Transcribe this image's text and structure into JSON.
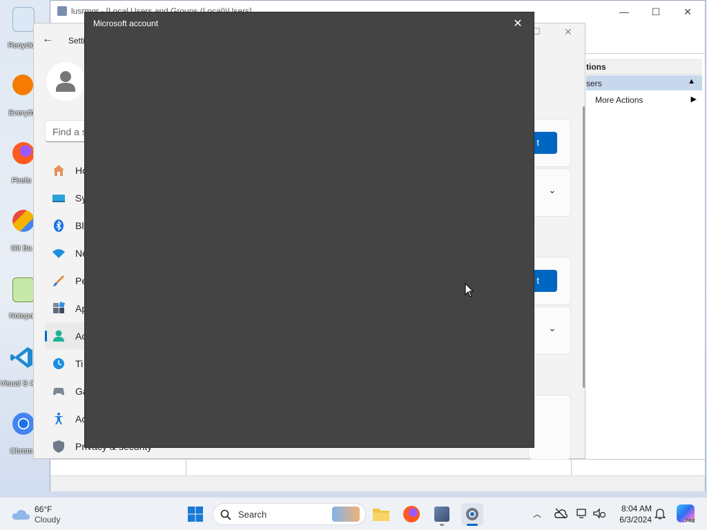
{
  "desktop": {
    "icons": [
      {
        "label": "Recycle"
      },
      {
        "label": "Everyth"
      },
      {
        "label": "Firefo"
      },
      {
        "label": "Git Ba"
      },
      {
        "label": "Notepa"
      },
      {
        "label": "Visual S Cod"
      },
      {
        "label": "Chrom"
      }
    ]
  },
  "lusrmgr": {
    "title": "lusrmgr - [Local Users and Groups (Local)\\Users]",
    "actions_header": "tions",
    "users_item": "sers",
    "more_actions": "More Actions"
  },
  "settings": {
    "back_label": "Setti",
    "search_placeholder": "Find a s",
    "nav": [
      {
        "label": "Ho",
        "icon": "home-icon"
      },
      {
        "label": "Sy",
        "icon": "system-icon"
      },
      {
        "label": "Bl",
        "icon": "bluetooth-icon"
      },
      {
        "label": "Ne",
        "icon": "network-icon"
      },
      {
        "label": "Pe",
        "icon": "personalization-icon"
      },
      {
        "label": "Ap",
        "icon": "apps-icon"
      },
      {
        "label": "Ac",
        "icon": "accounts-icon"
      },
      {
        "label": "Ti",
        "icon": "time-icon"
      },
      {
        "label": "Ga",
        "icon": "gaming-icon"
      },
      {
        "label": "Ac",
        "icon": "accessibility-icon"
      },
      {
        "label": "Privacy & security",
        "icon": "shield-icon"
      }
    ],
    "button1_label": "t",
    "button2_label": "t"
  },
  "dialog": {
    "title": "Microsoft account",
    "close_glyph": "✕"
  },
  "taskbar": {
    "weather_temp": "66°F",
    "weather_desc": "Cloudy",
    "search_label": "Search",
    "time": "8:04 AM",
    "date": "6/3/2024",
    "pre_badge": "PRE"
  }
}
